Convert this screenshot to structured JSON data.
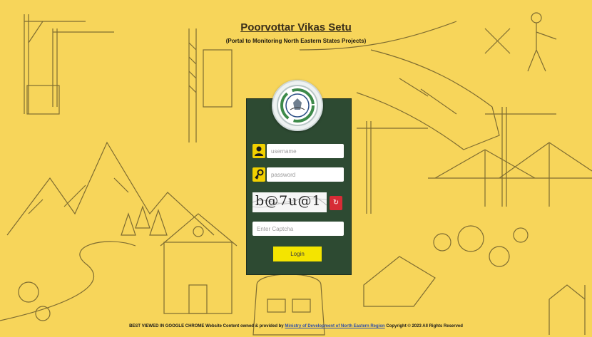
{
  "header": {
    "title": "Poorvottar Vikas Setu",
    "subtitle": "(Portal to Monitoring North Eastern States Projects)"
  },
  "login_form": {
    "username_placeholder": "username",
    "password_placeholder": "password",
    "captcha_text": "b@7u@1",
    "captcha_placeholder": "Enter Captcha",
    "login_label": "Login",
    "refresh_icon": "refresh-icon"
  },
  "footer": {
    "prefix": "BEST VIEWED IN GOOGLE CHROME Website Content owned & provided by",
    "link": "Ministry of Development of North Eastern Region",
    "suffix": "Copyright © 2023 All Rights Reserved"
  },
  "colors": {
    "background": "#f7d55a",
    "panel": "#2d4a32",
    "icon_box": "#f1d000",
    "refresh_button": "#d62c36",
    "login_button": "#f4e400"
  }
}
